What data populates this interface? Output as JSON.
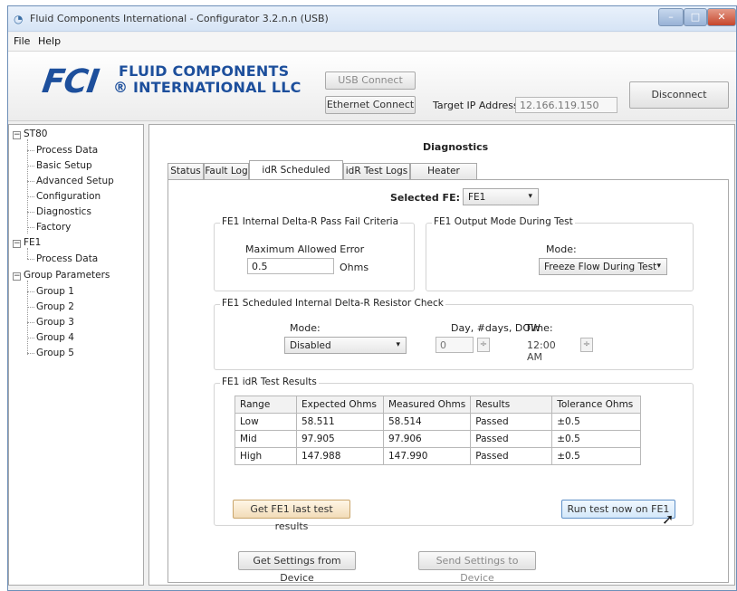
{
  "window": {
    "title": "Fluid Components International - Configurator 3.2.n.n (USB)",
    "minimize_glyph": "–",
    "maximize_glyph": "□",
    "close_glyph": "✕"
  },
  "menu": [
    "File",
    "Help"
  ],
  "header": {
    "logo_mark": "FCI",
    "logo_line1": "FLUID COMPONENTS",
    "logo_line2": "® INTERNATIONAL LLC",
    "usb_connect": "USB Connect",
    "ethernet_connect": "Ethernet Connect",
    "target_ip_label": "Target IP Address:",
    "target_ip_value": "12.166.119.150",
    "disconnect": "Disconnect"
  },
  "tree": {
    "root": "ST80",
    "root_children": [
      "Process Data",
      "Basic Setup",
      "Advanced Setup",
      "Configuration",
      "Diagnostics",
      "Factory"
    ],
    "fe1": "FE1",
    "fe1_children": [
      "Process Data"
    ],
    "group_parameters": "Group Parameters",
    "group_children": [
      "Group 1",
      "Group 2",
      "Group 3",
      "Group 4",
      "Group 5"
    ]
  },
  "diagnostics": {
    "title": "Diagnostics",
    "tabs": [
      "Status",
      "Fault Log",
      "idR Scheduled Tests",
      "idR Test Logs",
      "Heater Values"
    ],
    "active_tab": "idR Scheduled Tests",
    "selected_fe_label": "Selected FE:",
    "selected_fe_value": "FE1",
    "pass_fail": {
      "title": "FE1 Internal Delta-R Pass Fail Criteria",
      "max_error_label": "Maximum Allowed Error",
      "max_error_value": "0.5",
      "unit": "Ohms"
    },
    "output_mode": {
      "title": "FE1 Output Mode During Test",
      "mode_label": "Mode:",
      "mode_value": "Freeze Flow During Test"
    },
    "scheduled_check": {
      "title": "FE1 Scheduled Internal Delta-R Resistor Check",
      "mode_label": "Mode:",
      "mode_value": "Disabled",
      "day_label": "Day, #days, DOW",
      "day_value": "0",
      "time_label": "Time:",
      "time_value": "12:00 AM"
    },
    "results": {
      "title": "FE1 idR Test Results",
      "columns": [
        "Range",
        "Expected Ohms",
        "Measured Ohms",
        "Results",
        "Tolerance Ohms"
      ],
      "rows": [
        [
          "Low",
          "58.511",
          "58.514",
          "Passed",
          "±0.5"
        ],
        [
          "Mid",
          "97.905",
          "97.906",
          "Passed",
          "±0.5"
        ],
        [
          "High",
          "147.988",
          "147.990",
          "Passed",
          "±0.5"
        ]
      ],
      "get_last_button": "Get FE1 last test results",
      "run_now_button": "Run test now on FE1"
    },
    "get_settings_button": "Get Settings from Device",
    "send_settings_button": "Send Settings to Device"
  },
  "icons": {
    "app": "app-icon",
    "dropdown": "▾",
    "spin": "÷",
    "cursor": "mouse-cursor-icon"
  }
}
